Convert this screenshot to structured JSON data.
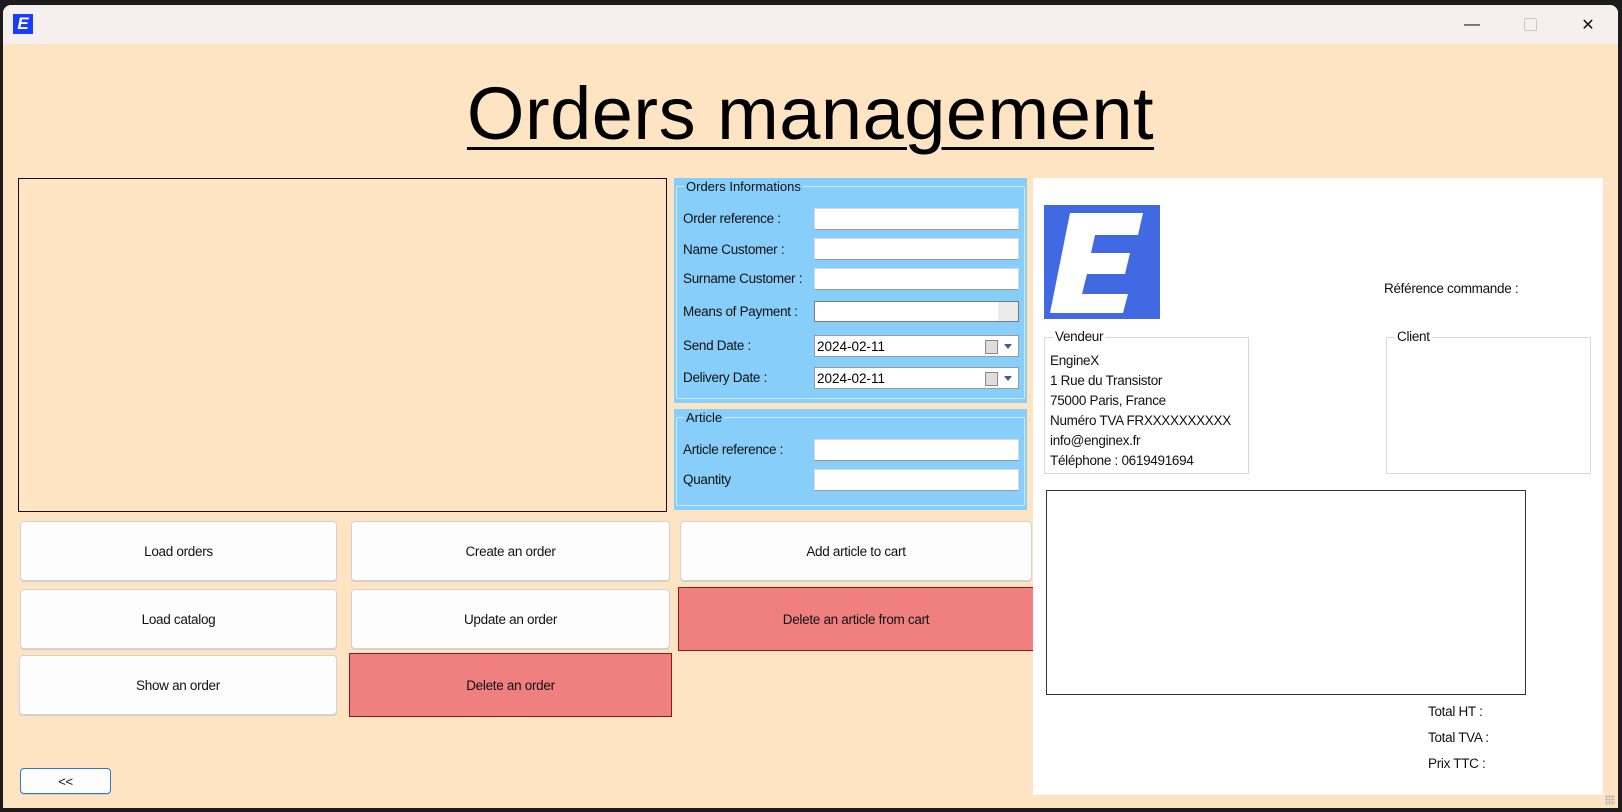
{
  "window": {
    "app_icon_letter": "E",
    "controls": {
      "minimize": "—",
      "maximize": "",
      "close": "✕"
    }
  },
  "header": {
    "title": "Orders management"
  },
  "orders_grid": {
    "rows": []
  },
  "orders_info": {
    "legend": "Orders Informations",
    "fields": {
      "order_reference": {
        "label": "Order reference :",
        "value": ""
      },
      "name_customer": {
        "label": "Name Customer :",
        "value": ""
      },
      "surname_customer": {
        "label": "Surname Customer :",
        "value": ""
      },
      "means_of_payment": {
        "label": "Means of Payment :",
        "value": ""
      },
      "send_date": {
        "label": "Send Date :",
        "value": "2024-02-11"
      },
      "delivery_date": {
        "label": "Delivery Date :",
        "value": "2024-02-11"
      }
    }
  },
  "article": {
    "legend": "Article",
    "fields": {
      "article_reference": {
        "label": "Article reference :",
        "value": ""
      },
      "quantity": {
        "label": "Quantity",
        "value": ""
      }
    }
  },
  "buttons": {
    "load_orders": "Load orders",
    "create_order": "Create an order",
    "add_article": "Add article to cart",
    "load_catalog": "Load catalog",
    "update_order": "Update an order",
    "delete_article": "Delete an article from cart",
    "show_order": "Show an order",
    "delete_order": "Delete an order",
    "back": "<<"
  },
  "invoice": {
    "logo_letter": "E",
    "reference_label": "Référence commande :",
    "vendor": {
      "legend": "Vendeur",
      "lines": [
        "EngineX",
        "1 Rue du Transistor",
        "75000 Paris, France",
        "Numéro TVA FRXXXXXXXXXX",
        "info@enginex.fr",
        "Téléphone : 0619491694"
      ]
    },
    "client": {
      "legend": "Client",
      "lines": []
    },
    "cart_items": [],
    "totals": {
      "total_ht": "Total HT :",
      "total_tva": "Total TVA :",
      "prix_ttc": "Prix TTC :"
    }
  },
  "colors": {
    "background": "#ffe4c4",
    "group_blue": "#87cefa",
    "danger": "#f08080",
    "logo_blue": "#4169e1",
    "app_icon_blue": "#1a3cff"
  }
}
